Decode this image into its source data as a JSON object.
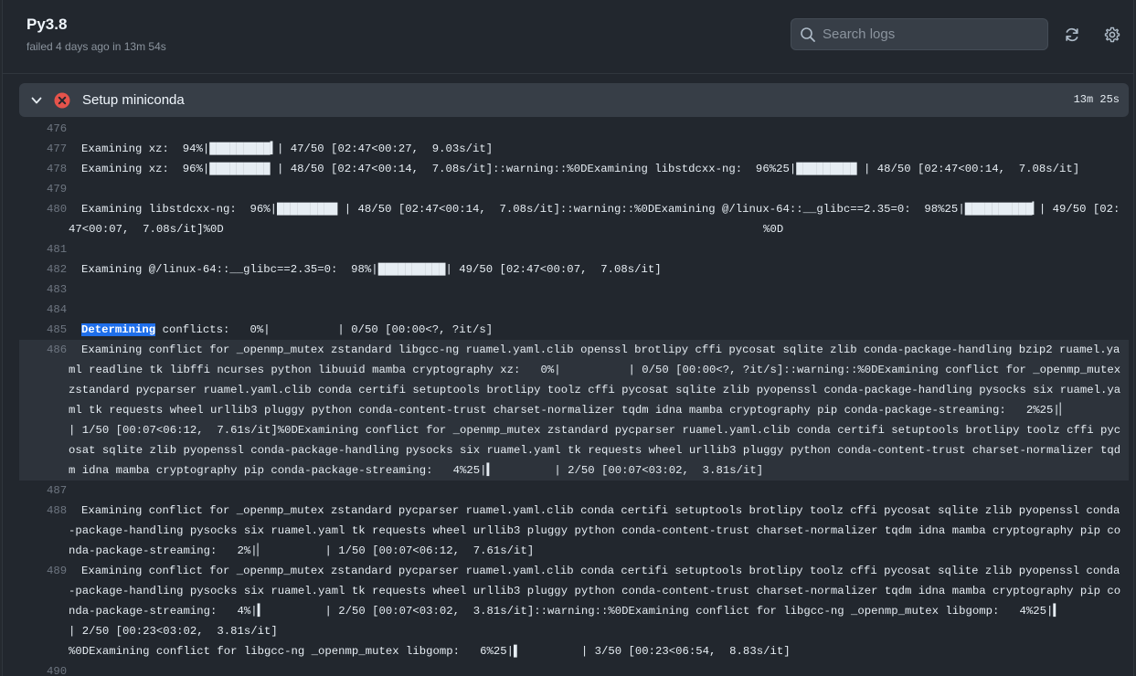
{
  "header": {
    "title": "Py3.8",
    "subtitle": "failed 4 days ago in 13m 54s",
    "search_placeholder": "Search logs"
  },
  "step": {
    "name": "Setup miniconda",
    "duration": "13m 25s",
    "status_color": "#e5534b"
  },
  "log": {
    "l476": {
      "num": "476",
      "text": ""
    },
    "l477": {
      "num": "477",
      "text": "Examining xz:  94%|█████████▍| 47/50 [02:47<00:27,  9.03s/it]"
    },
    "l478": {
      "num": "478",
      "text": "Examining xz:  96%|█████████ | 48/50 [02:47<00:14,  7.08s/it]::warning::%0DExamining libstdcxx-ng:  96%25|█████████ | 48/50 [02:47<00:14,  7.08s/it]"
    },
    "l479": {
      "num": "479",
      "text": ""
    },
    "l480": {
      "num": "480",
      "text": "Examining libstdcxx-ng:  96%|█████████ | 48/50 [02:47<00:14,  7.08s/it]::warning::%0DExamining @/linux-64::__glibc==2.35=0:  98%25|██████████▎| 49/50 [02:47<00:07,  7.08s/it]%0D                                                                                %0D"
    },
    "l481": {
      "num": "481",
      "text": ""
    },
    "l482": {
      "num": "482",
      "text": "Examining @/linux-64::__glibc==2.35=0:  98%|██████████| 49/50 [02:47<00:07,  7.08s/it]"
    },
    "l483": {
      "num": "483",
      "text": ""
    },
    "l484": {
      "num": "484",
      "text": ""
    },
    "l485": {
      "num": "485",
      "sel": "Determining",
      "text": " conflicts:   0%|          | 0/50 [00:00<?, ?it/s]"
    },
    "l486": {
      "num": "486",
      "text": "Examining conflict for _openmp_mutex zstandard libgcc-ng ruamel.yaml.clib openssl brotlipy cffi pycosat sqlite zlib conda-package-handling bzip2 ruamel.yaml readline tk libffi ncurses python libuuid mamba cryptography xz:   0%|          | 0/50 [00:00<?, ?it/s]::warning::%0DExamining conflict for _openmp_mutex zstandard pycparser ruamel.yaml.clib conda certifi setuptools brotlipy toolz cffi pycosat sqlite zlib pyopenssl conda-package-handling pysocks six ruamel.yaml tk requests wheel urllib3 pluggy python conda-content-trust charset-normalizer tqdm idna mamba cryptography pip conda-package-streaming:   2%25|▏         | 1/50 [00:07<06:12,  7.61s/it]%0DExamining conflict for _openmp_mutex zstandard pycparser ruamel.yaml.clib conda certifi setuptools brotlipy toolz cffi pycosat sqlite zlib pyopenssl conda-package-handling pysocks six ruamel.yaml tk requests wheel urllib3 pluggy python conda-content-trust charset-normalizer tqdm idna mamba cryptography pip conda-package-streaming:   4%25|▍         | 2/50 [00:07<03:02,  3.81s/it]"
    },
    "l487": {
      "num": "487",
      "text": ""
    },
    "l488": {
      "num": "488",
      "text": "Examining conflict for _openmp_mutex zstandard pycparser ruamel.yaml.clib conda certifi setuptools brotlipy toolz cffi pycosat sqlite zlib pyopenssl conda-package-handling pysocks six ruamel.yaml tk requests wheel urllib3 pluggy python conda-content-trust charset-normalizer tqdm idna mamba cryptography pip conda-package-streaming:   2%|▏         | 1/50 [00:07<06:12,  7.61s/it]"
    },
    "l489": {
      "num": "489",
      "text": "Examining conflict for _openmp_mutex zstandard pycparser ruamel.yaml.clib conda certifi setuptools brotlipy toolz cffi pycosat sqlite zlib pyopenssl conda-package-handling pysocks six ruamel.yaml tk requests wheel urllib3 pluggy python conda-content-trust charset-normalizer tqdm idna mamba cryptography pip conda-package-streaming:   4%|▍         | 2/50 [00:07<03:02,  3.81s/it]::warning::%0DExamining conflict for libgcc-ng _openmp_mutex libgomp:   4%25|▍         | 2/50 [00:23<03:02,  3.81s/it]\n%0DExamining conflict for libgcc-ng _openmp_mutex libgomp:   6%25|▌         | 3/50 [00:23<06:54,  8.83s/it]"
    },
    "l490": {
      "num": "490",
      "text": ""
    }
  }
}
